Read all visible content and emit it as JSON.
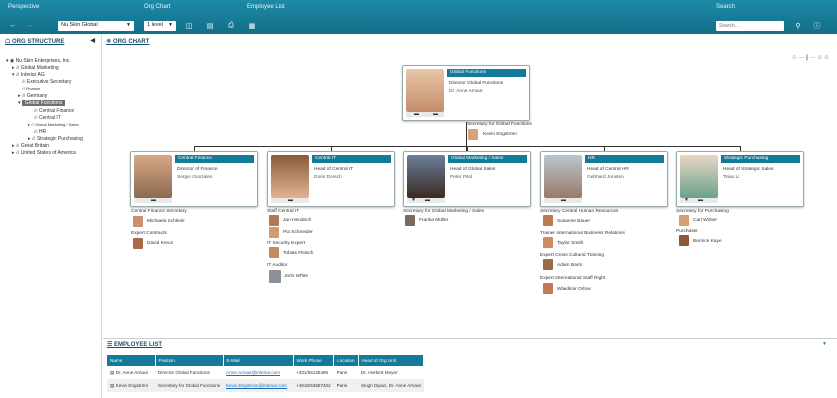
{
  "toolbar": {
    "perspective_label": "Perspective",
    "orgchart_label": "Org Chart",
    "employeelist_label": "Employee List",
    "search_label": "Search",
    "perspective_value": "Nu Skin Global",
    "level_value": "1 level",
    "search_placeholder": "Search..."
  },
  "left": {
    "title": "ORG STRUCTURE",
    "tree": [
      "Nu Skin Enterprises, Inc.",
      "Global Marketing",
      "Interiar AG",
      "Executive Secretary",
      "Finance",
      "Germany",
      "Global Functions",
      "Central Finance",
      "Central IT",
      "Global Marketing / Sales",
      "HR",
      "Strategic Purchasing",
      "Great Britain",
      "United States of America"
    ]
  },
  "orgchart": {
    "title": "ORG CHART",
    "root": {
      "title": "Global Functions",
      "role": "Director Global Functions",
      "name": "Dr. Anne Arnaut"
    },
    "secretary_role": "Secretary for Global Functions",
    "secretary_name": "Kevin Engström",
    "cards": [
      {
        "title": "Central Finance",
        "role": "Director of Finance",
        "name": "Sergio Gonzales"
      },
      {
        "title": "Central IT",
        "role": "Head of Central IT",
        "name": "Doris Dorsch"
      },
      {
        "title": "Global Marketing / Sales",
        "role": "Head of Global Sales",
        "name": "Peter Pitol"
      },
      {
        "title": "HR",
        "role": "Head of Central HR",
        "name": "Gebhard Jonsten"
      },
      {
        "title": "Strategic Purchasing",
        "role": "Head of Strategic Sales",
        "name": "Tsiau Li"
      }
    ],
    "subs": {
      "col1": [
        {
          "role": "Central Finance Secretary",
          "name": "Michaela Schlenk"
        },
        {
          "role": "Expert Contracts",
          "name": "David Kreuz"
        }
      ],
      "col2": [
        {
          "role": "Staff Central IT",
          "name": "Jan Hendrich"
        },
        {
          "role": "",
          "name": "Pia Schneider"
        },
        {
          "role": "IT Security Expert",
          "name": "Tobias Fleisch"
        },
        {
          "role": "IT Auditor",
          "name": "John White"
        }
      ],
      "col3": [
        {
          "role": "Secretary for Global Marketing / Sales",
          "name": "Franka Müller"
        }
      ],
      "col4": [
        {
          "role": "Secretary Central Human Resources",
          "name": "Susanne Bauer"
        },
        {
          "role": "Trainer International Business Relations",
          "name": "Taylor Smith"
        },
        {
          "role": "Expert Cross Cultural Training",
          "name": "Adam Barrs"
        },
        {
          "role": "Expert International Staff Right",
          "name": "Wlaidimir Orlow"
        }
      ],
      "col5": [
        {
          "role": "Secretary for Purchasing",
          "name": "Carl Winter"
        },
        {
          "role": "Purchaser",
          "name": "Bernice Kaye"
        }
      ]
    }
  },
  "employee_list": {
    "title": "EMPLOYEE LIST",
    "columns": [
      "Name",
      "Position",
      "E-Mail",
      "Work Phone",
      "Location",
      "Head of Org Unit"
    ],
    "rows": [
      [
        "Dr. Anne Arnaut",
        "Director Global Functions",
        "Anne.Arnaut@interiar.com",
        "+331/55125485",
        "Paris",
        "Dr. Herbert Meyer"
      ],
      [
        "Kevin Engström",
        "Secretary for Global Functions",
        "Kevin.Engstrom@interiar.com",
        "+4916/53587402",
        "Paris",
        "Singh Dipan, Dr. Anne Arnaut"
      ]
    ]
  },
  "colors": {
    "brand": "#137a99",
    "toolbar": "#1c8aa8"
  }
}
